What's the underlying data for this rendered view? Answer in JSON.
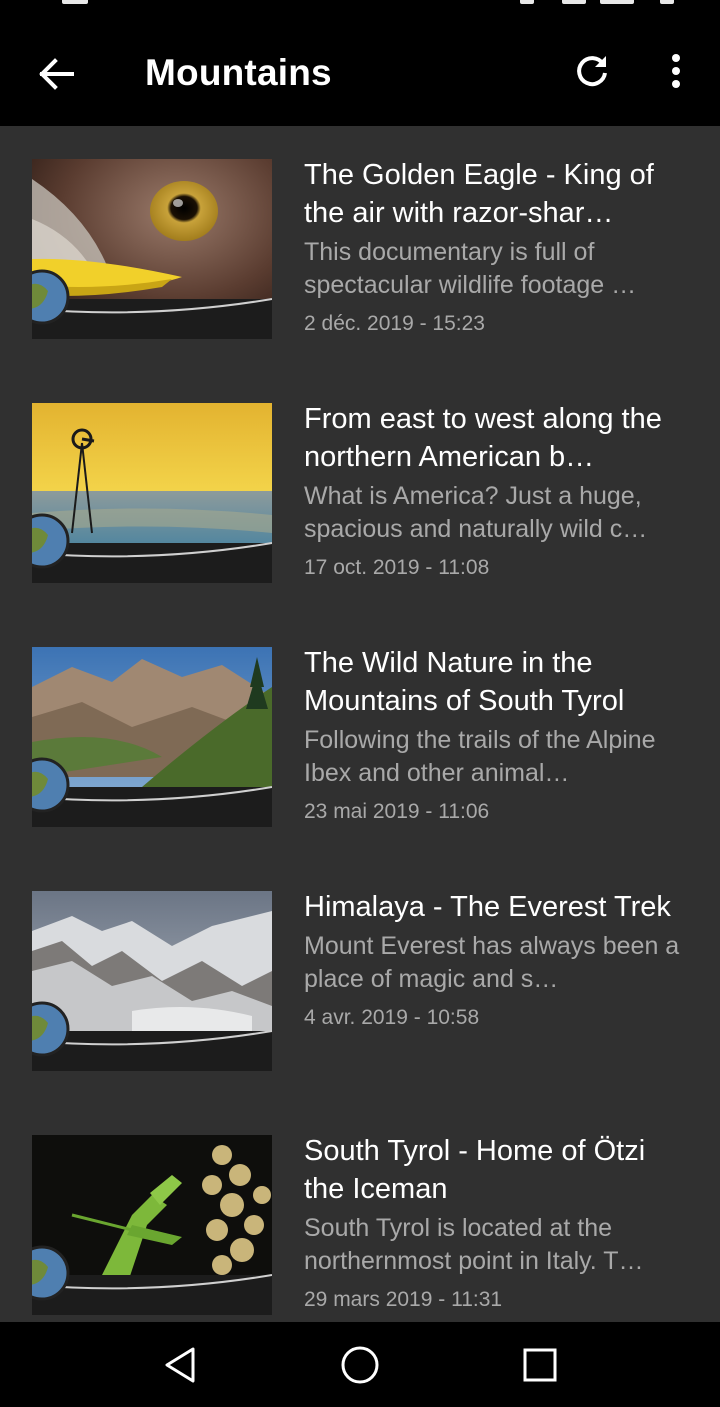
{
  "header": {
    "title": "Mountains",
    "back_icon": "arrow-back-icon",
    "refresh_icon": "refresh-icon",
    "more_icon": "more-vert-icon"
  },
  "items": [
    {
      "title": "The Golden Eagle - King of the air with razor-shar…",
      "description": "This documentary is full of spectacular wildlife footage …",
      "date": "2 déc. 2019 - 15:23"
    },
    {
      "title": "From east to west along the northern American b…",
      "description": "What is America? Just a huge, spacious and naturally wild c…",
      "date": "17 oct. 2019 - 11:08"
    },
    {
      "title": "The Wild Nature in the Mountains of South Tyrol",
      "description": "Following the trails of the Alpine Ibex and other animal…",
      "date": "23 mai 2019 - 11:06"
    },
    {
      "title": "Himalaya - The Everest Trek",
      "description": "Mount Everest has always been a place of magic and s…",
      "date": "4 avr. 2019 - 10:58"
    },
    {
      "title": "South Tyrol - Home of Ötzi the Iceman",
      "description": "South Tyrol is located at the northernmost point in Italy. T…",
      "date": "29 mars 2019 - 11:31"
    }
  ],
  "navbar": {
    "back_icon": "nav-back-triangle-icon",
    "home_icon": "nav-home-circle-icon",
    "recents_icon": "nav-recents-square-icon"
  },
  "colors": {
    "background": "#303030",
    "appbar": "#000000",
    "title_text": "#ffffff",
    "secondary_text": "#a9a9a9"
  }
}
